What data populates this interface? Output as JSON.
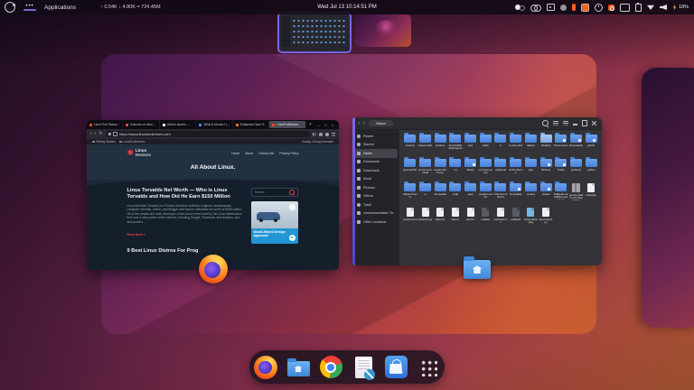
{
  "topbar": {
    "workspace_dots": "•••",
    "applications_label": "Applications",
    "net_monitor": "↑ 0.54K ↓ 4.80K = 724.45M",
    "clock": "Wed Jul 13 10:14:51 PM",
    "battery_percent": "18%",
    "tray": [
      {
        "name": "dark-mode-toggle-icon",
        "type": "toggle"
      },
      {
        "name": "screen-record-icon",
        "type": "record"
      },
      {
        "name": "screenshot-tool-icon",
        "type": "screenshot"
      },
      {
        "name": "app-indicator-gray-icon",
        "type": "ind-gray"
      },
      {
        "name": "app-indicator-orange-bar-icon",
        "type": "ind-bar"
      },
      {
        "name": "app-indicator-orange-icon",
        "type": "ind-orange"
      },
      {
        "name": "timer-indicator-icon",
        "type": "clockic"
      },
      {
        "name": "ubuntu-indicator-icon",
        "type": "ubuntu"
      },
      {
        "name": "display-indicator-icon",
        "type": "display"
      },
      {
        "name": "clipboard-indicator-icon",
        "type": "clipboard"
      },
      {
        "name": "wifi-icon",
        "type": "wifi"
      },
      {
        "name": "volume-icon",
        "type": "volume"
      }
    ]
  },
  "firefox": {
    "tabs": [
      {
        "title": "Linux First 'Rubax…'",
        "fav": "red"
      },
      {
        "title": "Kubuntu vs Ubun…",
        "fav": "red"
      },
      {
        "title": "what is ubuntu -…",
        "fav": "white"
      },
      {
        "title": "What is Ubuntu? |…",
        "fav": "blue"
      },
      {
        "title": "Enterprise Open S…",
        "fav": "orange"
      },
      {
        "title": "LinuxForDevices",
        "fav": "red",
        "state": "active"
      }
    ],
    "new_tab_label": "+",
    "window_controls": "– □ ×",
    "nav": {
      "back": "‹",
      "forward": "›",
      "reload": "↻"
    },
    "url": "https://www.linuxfordevices.com",
    "nav_icons": [
      {
        "name": "sidebar-toggle-icon",
        "type": "sidebar"
      },
      {
        "name": "extensions-icon",
        "type": "ext"
      },
      {
        "name": "account-icon",
        "type": "account"
      },
      {
        "name": "menu-icon",
        "type": "menu"
      }
    ],
    "bookmarks_left": [
      {
        "label": "Getting Started"
      },
      {
        "label": "LinuxForDevices"
      }
    ],
    "bookmarks_right": "Howdy, Chirag Devnaani",
    "site": {
      "logo_mark": "✱",
      "logo_top": "Linux",
      "logo_bottom": "Devices",
      "nav": [
        {
          "label": "Home"
        },
        {
          "label": "About"
        },
        {
          "label": "Contact Me"
        },
        {
          "label": "Privacy Policy"
        }
      ],
      "hero_title": "All About Linux.",
      "article_title": "Linus Torvalds Net Worth — Who is Linus Torvalds and How Did He Earn $150 Million",
      "article_excerpt": "Linus Benedict Torvalds is a Finnish-American software engineer, businessman, computer scientist, author, and blogger who has an estimated net worth of $150 million. He is the creator and main developer of the Linux kernel used by the Linux distributions that runs a vast portion of the internet, including Google, Facebook, and Amazon, and also powers ...",
      "read_more": "Read More »",
      "next_article_title": "9 Best Linux Distros For Prog",
      "search_placeholder": "Search ...",
      "ad_caption": "Model-Based Design Approach"
    }
  },
  "files": {
    "nav": {
      "back": "‹",
      "forward": "›"
    },
    "path_label": "Home",
    "header_icons": [
      {
        "name": "search-icon",
        "type": "fsearch"
      },
      {
        "name": "view-toggle-icon",
        "type": "fview"
      },
      {
        "name": "menu-icon",
        "type": "fmenu"
      },
      {
        "name": "minimize-icon",
        "type": "fmin"
      },
      {
        "name": "maximize-icon",
        "type": "fmax"
      },
      {
        "name": "close-icon",
        "type": "fclose"
      }
    ],
    "sidebar": [
      {
        "label": "Recent",
        "icon": "clock"
      },
      {
        "label": "Starred",
        "icon": "star"
      },
      {
        "label": "Home",
        "icon": "home",
        "state": "selected"
      },
      {
        "label": "Documents",
        "icon": "doc"
      },
      {
        "label": "Downloads",
        "icon": "down"
      },
      {
        "label": "Music",
        "icon": "music"
      },
      {
        "label": "Pictures",
        "icon": "pic"
      },
      {
        "label": "Videos",
        "icon": "video"
      },
      {
        "label": "Trash",
        "icon": "trash"
      },
      {
        "label": "chromeuserdata1.7b…",
        "icon": "drive"
      },
      {
        "label": "Other Locations",
        "icon": "other"
      }
    ],
    "items": [
      {
        "label": "amazon",
        "type": "folder"
      },
      {
        "label": "anaconda3",
        "type": "folder"
      },
      {
        "label": "Android",
        "type": "folder"
      },
      {
        "label": "AndroidStudioProjects",
        "type": "folder"
      },
      {
        "label": "aws",
        "type": "folder"
      },
      {
        "label": "bash",
        "type": "folder"
      },
      {
        "label": "C",
        "type": "folder"
      },
      {
        "label": "C-plus-plus",
        "type": "folder"
      },
      {
        "label": "datard",
        "type": "folder"
      },
      {
        "label": "Desktop",
        "type": "folder-light"
      },
      {
        "label": "Documents",
        "type": "folder-em"
      },
      {
        "label": "Downloads",
        "type": "folder-em"
      },
      {
        "label": "github",
        "type": "folder-em"
      },
      {
        "label": "gnomeOS2",
        "type": "folder"
      },
      {
        "label": "icons-in-terminal",
        "type": "folder"
      },
      {
        "label": "LayerLab-theme",
        "type": "folder"
      },
      {
        "label": "ml",
        "type": "folder"
      },
      {
        "label": "Music",
        "type": "folder-em"
      },
      {
        "label": "my-linux-setup",
        "type": "folder"
      },
      {
        "label": "notebook",
        "type": "folder"
      },
      {
        "label": "orchis-theme",
        "type": "folder"
      },
      {
        "label": "php",
        "type": "folder"
      },
      {
        "label": "Pictures",
        "type": "folder-em"
      },
      {
        "label": "Public",
        "type": "folder-em"
      },
      {
        "label": "pycharm",
        "type": "folder"
      },
      {
        "label": "python",
        "type": "folder"
      },
      {
        "label": "Rader-theory",
        "type": "folder"
      },
      {
        "label": "vl",
        "type": "folder"
      },
      {
        "label": "vlc-toolbar",
        "type": "folder"
      },
      {
        "label": "snap",
        "type": "folder"
      },
      {
        "label": "spec",
        "type": "folder"
      },
      {
        "label": "sudoku-solver",
        "type": "folder"
      },
      {
        "label": "Orla-Icon-Theme",
        "type": "folder"
      },
      {
        "label": "Templates",
        "type": "folder-em"
      },
      {
        "label": "testing",
        "type": "folder"
      },
      {
        "label": "Videos",
        "type": "folder-em"
      },
      {
        "label": "Diabetes-prediction-using-ml",
        "type": "folder"
      },
      {
        "label": "gnome-kwd-1.4.5-Translation",
        "type": "archive"
      },
      {
        "label": "example",
        "type": "file"
      },
      {
        "label": "viewchat.txt",
        "type": "file"
      },
      {
        "label": "windows.py",
        "type": "file"
      },
      {
        "label": "Maxi.txt",
        "type": "file"
      },
      {
        "label": "electro",
        "type": "file"
      },
      {
        "label": "bashrc",
        "type": "file"
      },
      {
        "label": "untitled",
        "type": "file-dark"
      },
      {
        "label": "notebook.txt",
        "type": "file"
      },
      {
        "label": "untitled1",
        "type": "file-dark"
      },
      {
        "label": "screenshot.png",
        "type": "file-blue"
      },
      {
        "label": "word-cloud.py",
        "type": "file"
      }
    ]
  },
  "dock": {
    "items": [
      {
        "name": "firefox-dock-icon",
        "type": "firefox",
        "state": "running"
      },
      {
        "name": "files-dock-icon",
        "type": "files",
        "state": "running"
      },
      {
        "name": "chrome-dock-icon",
        "type": "chrome"
      },
      {
        "name": "text-editor-dock-icon",
        "type": "editor"
      },
      {
        "name": "ubuntu-software-dock-icon",
        "type": "software"
      },
      {
        "name": "show-apps-dock-icon",
        "type": "appgrid"
      }
    ]
  }
}
